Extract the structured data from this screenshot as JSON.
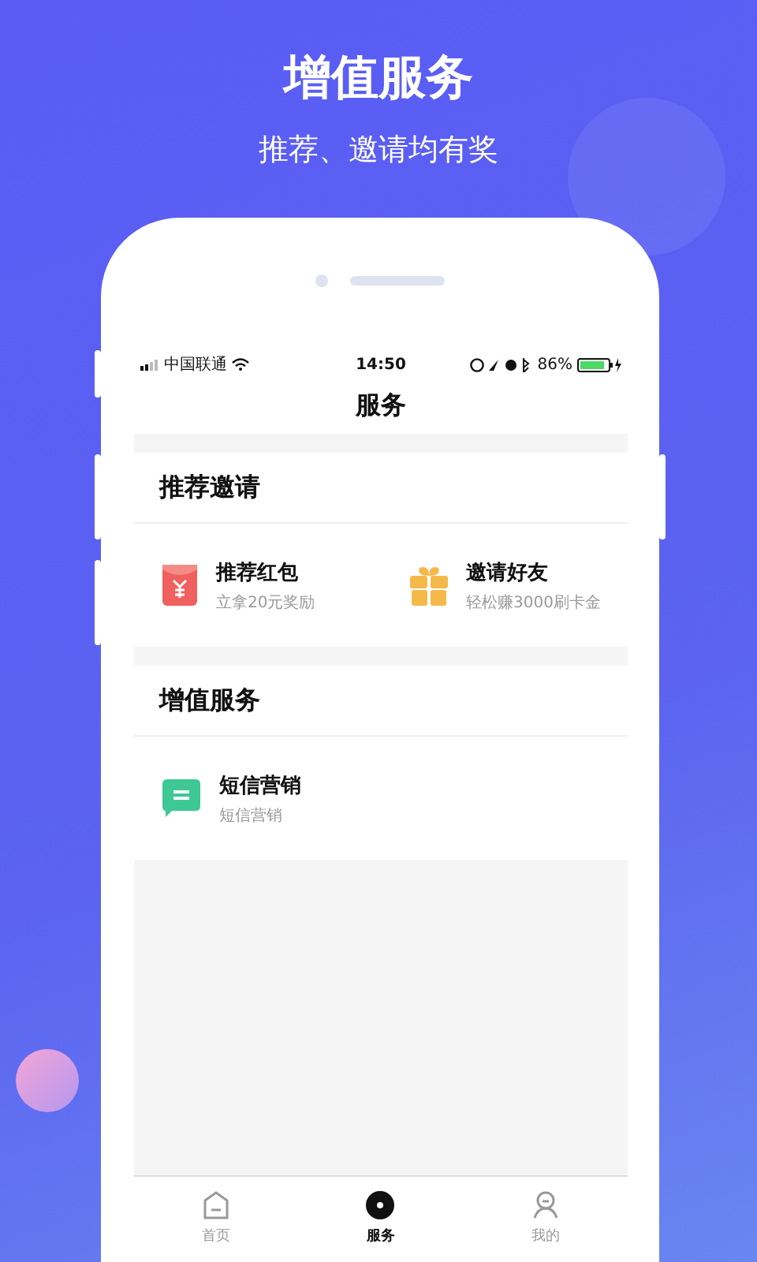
{
  "promo": {
    "title": "增值服务",
    "subtitle": "推荐、邀请均有奖"
  },
  "status_bar": {
    "carrier": "中国联通",
    "time": "14:50",
    "battery": "86%"
  },
  "nav": {
    "title": "服务"
  },
  "sections": [
    {
      "title": "推荐邀请",
      "items": [
        {
          "kind": "red-packet",
          "title": "推荐红包",
          "subtitle": "立拿20元奖励"
        },
        {
          "kind": "gift",
          "title": "邀请好友",
          "subtitle": "轻松赚3000刷卡金"
        }
      ]
    },
    {
      "title": "增值服务",
      "items": [
        {
          "kind": "message",
          "title": "短信营销",
          "subtitle": "短信营销"
        }
      ]
    }
  ],
  "tabs": [
    {
      "kind": "home",
      "label": "首页",
      "selected": false
    },
    {
      "kind": "service",
      "label": "服务",
      "selected": true
    },
    {
      "kind": "profile",
      "label": "我的",
      "selected": false
    }
  ]
}
